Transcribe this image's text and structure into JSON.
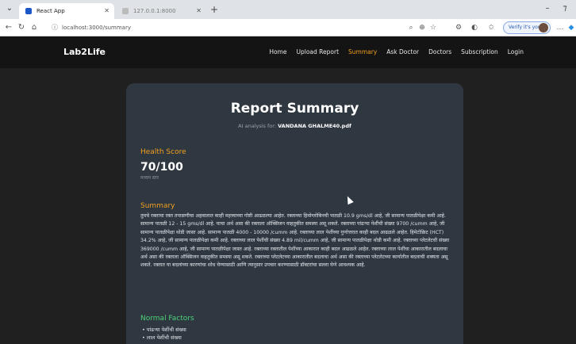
{
  "browser": {
    "tabs": [
      {
        "title": "React App",
        "active": true
      },
      {
        "title": "127.0.0.1:8000",
        "active": false
      }
    ],
    "url": "localhost:3000/summary",
    "profile_label": "Verify it's you"
  },
  "app": {
    "brand": "Lab2Life",
    "nav": [
      "Home",
      "Upload Report",
      "Summary",
      "Ask Doctor",
      "Doctors",
      "Subscription",
      "Login"
    ],
    "active_nav": "Summary"
  },
  "report": {
    "title": "Report Summary",
    "subtitle_prefix": "AI analysis for:",
    "file_name": "VANDANA GHALME40.pdf",
    "health_score_label": "Health Score",
    "health_score": "70/100",
    "health_score_sublabel": "मध्यम स्तर",
    "summary_label": "Summary",
    "summary_text": "तुमचे रक्ताचा रक्त तपासणीचा अहवालात काही महत्त्वाच्या गोष्टी आढळल्या आहेत. रक्ताच्या हिमोग्लोबिनची पातळी 10.9 gms/dl आहे, जी सामान्य पातळीपेक्षा कमी आहे. सामान्य पातळी 12 - 15 gms/dl आहे. याचा अर्थ असा की रक्ताला ऑक्सिजन वाहतुकीत समस्या असू शकते. रक्ताच्या पांढऱ्या पेशींची संख्या 9700 /cumm आहे, जी सामान्य पातळीपेक्षा थोडी जास्त आहे. सामान्य पातळी 4000 - 10000 /cumm आहे. रक्ताच्या लाल पेशींच्या गुणोत्तरात काही बदल आढळले आहेत. हिमेटोक्रिट (HCT) 34.2% आहे, जी सामान्य पातळीपेक्षा कमी आहे. रक्ताच्या लाल पेशींची संख्या 4.89 mil/cumm आहे, जी सामान्य पातळीपेक्षा थोडी कमी आहे. रक्ताच्या प्लेटलेटची संख्या 369000 /cumm आहे, जी सामान्य पातळीपेक्षा जास्त आहे. रक्ताच्या रक्तातील पेशींच्या आकारात काही बदल आढळले आहेत. रक्ताच्या लाल पेशींचा आकारातील बदलाचा अर्थ असा की रक्ताला ऑक्सिजन वाहतुकीत समस्या असू शकते. रक्ताच्या प्लेटलेटच्या आकारातील बदलाचा अर्थ असा की रक्ताच्या प्लेटलेटच्या कार्यातील बदलाची शक्यता असू शकते. रक्तात या बदलांच्या कारणांचा शोध घेण्यासाठी आणि त्यानुसार उपचार करण्यासाठी डॉक्टरांचा सल्ला घेणे आवश्यक आहे.",
    "normal_factors_label": "Normal Factors",
    "normal_factors": [
      "पांढऱ्या पेशींची संख्या",
      "लाल पेशींची संख्या"
    ]
  }
}
